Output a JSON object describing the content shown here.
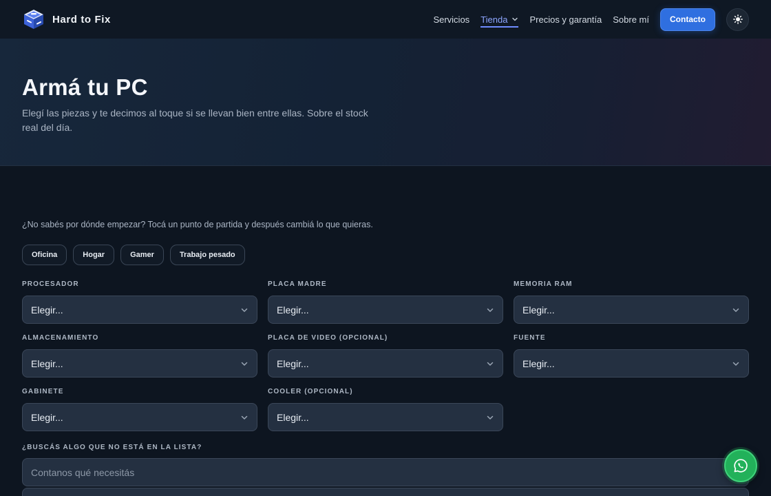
{
  "brand": {
    "name": "Hard to Fix",
    "logo_icon": "cube-wrench-icon"
  },
  "nav": {
    "items": [
      {
        "label": "Servicios"
      },
      {
        "label": "Tienda",
        "active": true,
        "has_dropdown": true
      },
      {
        "label": "Precios y garantía"
      },
      {
        "label": "Sobre mí"
      }
    ],
    "contact_label": "Contacto",
    "theme_icon": "sun-icon"
  },
  "hero": {
    "title": "Armá tu PC",
    "subtitle": "Elegí las piezas y te decimos al toque si se llevan bien entre ellas. Sobre el stock real del día."
  },
  "builder": {
    "intro": "¿No sabés por dónde empezar? Tocá un punto de partida y después cambiá lo que quieras.",
    "presets": [
      "Oficina",
      "Hogar",
      "Gamer",
      "Trabajo pesado"
    ],
    "fields": [
      {
        "label": "PROCESADOR",
        "value": "Elegir..."
      },
      {
        "label": "PLACA MADRE",
        "value": "Elegir..."
      },
      {
        "label": "MEMORIA RAM",
        "value": "Elegir..."
      },
      {
        "label": "ALMACENAMIENTO",
        "value": "Elegir..."
      },
      {
        "label": "PLACA DE VIDEO (OPCIONAL)",
        "value": "Elegir..."
      },
      {
        "label": "FUENTE",
        "value": "Elegir..."
      },
      {
        "label": "GABINETE",
        "value": "Elegir..."
      },
      {
        "label": "COOLER (OPCIONAL)",
        "value": "Elegir..."
      }
    ],
    "extra": {
      "label": "¿BUSCÁS ALGO QUE NO ESTÁ EN LA LISTA?",
      "placeholder": "Contanos qué necesitás"
    }
  },
  "whatsapp": {
    "icon": "whatsapp-icon"
  },
  "colors": {
    "accent": "#2f6fe0",
    "nav_active": "#8ea6ff",
    "whatsapp": "#22b15a",
    "background": "#0d1520"
  }
}
